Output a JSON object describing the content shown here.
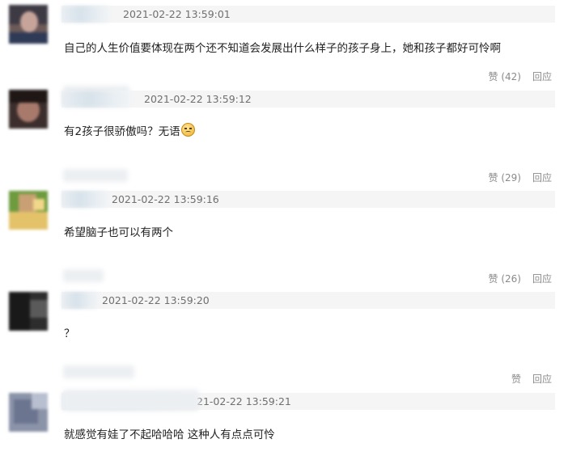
{
  "comments": [
    {
      "timestamp": "2021-02-22 13:59:01",
      "content": "自己的人生价值要体现在两个还不知道会发展出什么样子的孩子身上，她和孩子都好可怜啊",
      "like_label": "赞 (42)",
      "reply_label": "回应"
    },
    {
      "timestamp": "2021-02-22 13:59:12",
      "content": "有2孩子很骄傲吗？无语",
      "emoji": "sad-face-emoji",
      "like_label": "赞 (29)",
      "reply_label": "回应"
    },
    {
      "timestamp": "2021-02-22 13:59:16",
      "content": "希望脑子也可以有两个",
      "like_label": "赞 (26)",
      "reply_label": "回应"
    },
    {
      "timestamp": "2021-02-22 13:59:20",
      "content": "？",
      "like_label": "赞",
      "reply_label": "回应"
    },
    {
      "timestamp": "21-02-22 13:59:21",
      "content": "就感觉有娃了不起哈哈哈 这种人有点点可怜"
    }
  ]
}
